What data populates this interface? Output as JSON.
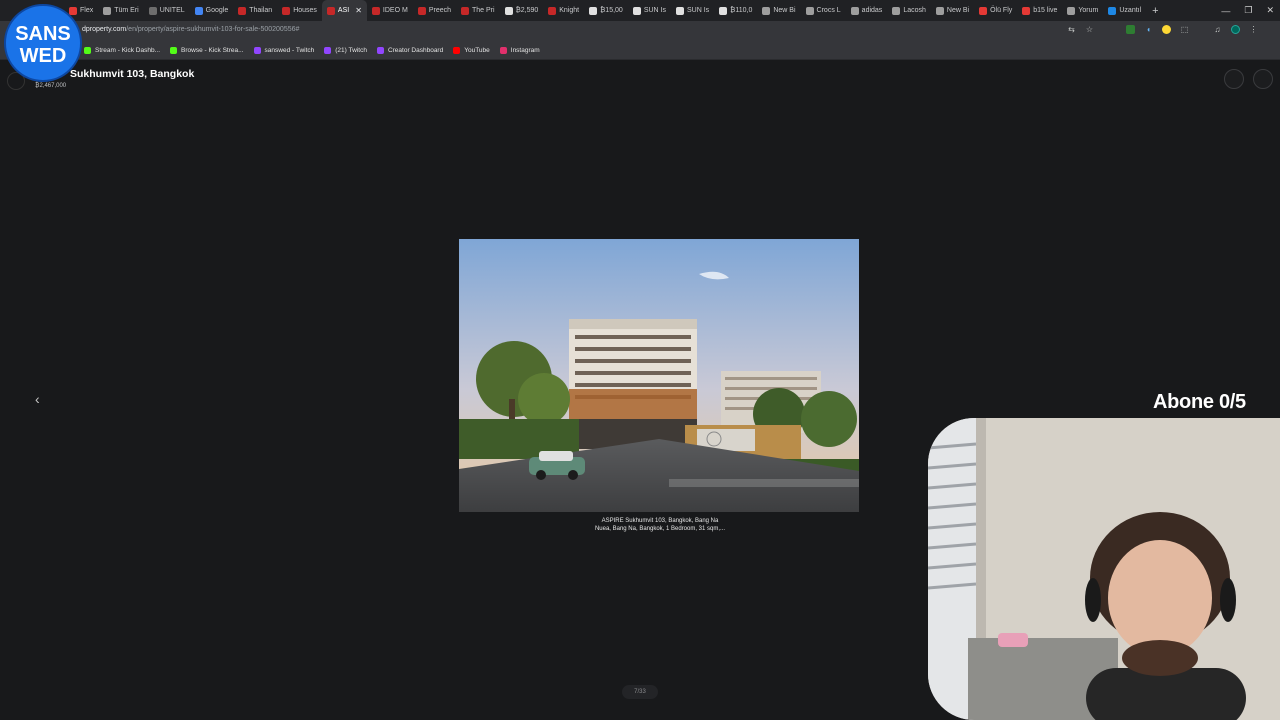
{
  "browser": {
    "tabs": [
      {
        "label": "Flex",
        "color": "#e53935"
      },
      {
        "label": "Tüm Eri",
        "color": "#9e9e9e"
      },
      {
        "label": "UNITEL",
        "color": "#6d6d6d"
      },
      {
        "label": "Google",
        "color": "#4285f4"
      },
      {
        "label": "Thailan",
        "color": "#c62828"
      },
      {
        "label": "Houses",
        "color": "#c62828"
      },
      {
        "label": "ASI",
        "color": "#c62828",
        "active": true
      },
      {
        "label": "IDEO M",
        "color": "#c62828"
      },
      {
        "label": "Preech",
        "color": "#c62828"
      },
      {
        "label": "The Pri",
        "color": "#c62828"
      },
      {
        "label": "₿2,590",
        "color": "#e0e0e0"
      },
      {
        "label": "Knight",
        "color": "#c62828"
      },
      {
        "label": "₿15,00",
        "color": "#e0e0e0"
      },
      {
        "label": "SUN Is",
        "color": "#e0e0e0"
      },
      {
        "label": "SUN Is",
        "color": "#e0e0e0"
      },
      {
        "label": "₿110,0",
        "color": "#e0e0e0"
      },
      {
        "label": "New Bi",
        "color": "#9e9e9e"
      },
      {
        "label": "Crocs L",
        "color": "#9e9e9e"
      },
      {
        "label": "adidas",
        "color": "#9e9e9e"
      },
      {
        "label": "Lacosh",
        "color": "#9e9e9e"
      },
      {
        "label": "New Bi",
        "color": "#9e9e9e"
      },
      {
        "label": "Ölü Fly",
        "color": "#e53935"
      },
      {
        "label": "b15 live",
        "color": "#e53935"
      },
      {
        "label": "Yorum",
        "color": "#9e9e9e"
      },
      {
        "label": "Uzantıl",
        "color": "#1e88e5"
      }
    ],
    "url_host": "dproperty.com",
    "url_path": "/en/property/aspire-sukhumvit-103-for-sale-500200556#",
    "bookmarks": [
      {
        "label": "Stream - Kick Dashb...",
        "color": "#53fc18"
      },
      {
        "label": "Browse - Kick Strea...",
        "color": "#53fc18"
      },
      {
        "label": "sanswed - Twitch",
        "color": "#9146ff"
      },
      {
        "label": "(21) Twitch",
        "color": "#9146ff"
      },
      {
        "label": "Creator Dashboard",
        "color": "#9146ff"
      },
      {
        "label": "YouTube",
        "color": "#ff0000"
      },
      {
        "label": "Instagram",
        "color": "#e1306c"
      }
    ]
  },
  "property": {
    "title": "Sukhumvit 103, Bangkok",
    "price": "₿2,467,000",
    "caption_line1": "ASPIRE Sukhumvit 103, Bangkok, Bang Na",
    "caption_line2": "Nuea, Bang Na, Bangkok, 1 Bedroom, 31 sqm,...",
    "counter": "7/33"
  },
  "overlay": {
    "logo_line1": "SANS",
    "logo_line2": "WED",
    "abone": "Abone 0/5"
  }
}
